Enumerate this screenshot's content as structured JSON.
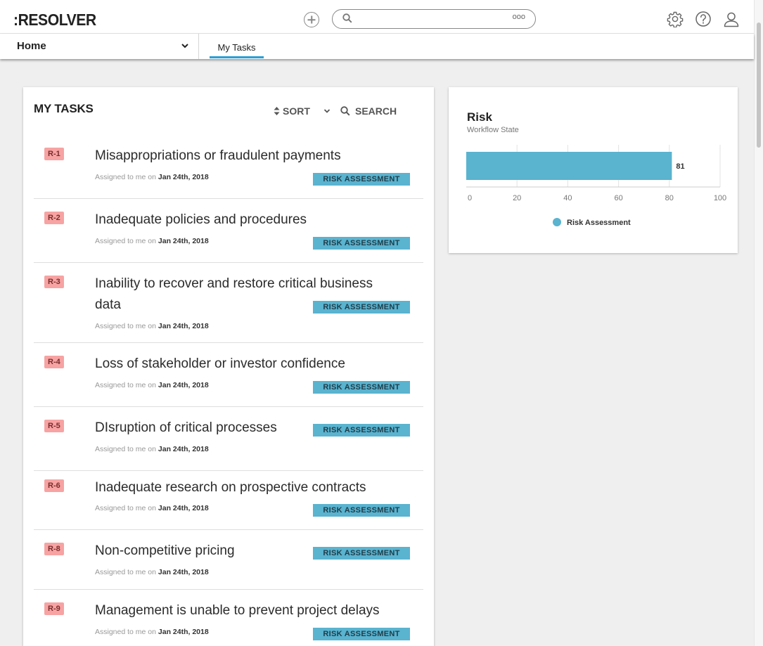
{
  "header": {
    "logo": ":RESOLVER",
    "search_placeholder": "",
    "more_label": "ooo"
  },
  "nav": {
    "home_label": "Home",
    "tab_label": "My Tasks"
  },
  "tasks_panel": {
    "title": "MY TASKS",
    "sort_label": "SORT",
    "search_label": "SEARCH",
    "tasks": [
      {
        "id": "R-1",
        "title": "Misappropriations or fraudulent payments",
        "assigned_prefix": "Assigned to me on",
        "date": "Jan 24th, 2018",
        "state": "RISK ASSESSMENT"
      },
      {
        "id": "R-2",
        "title": "Inadequate policies and procedures",
        "assigned_prefix": "Assigned to me on",
        "date": "Jan 24th, 2018",
        "state": "RISK ASSESSMENT"
      },
      {
        "id": "R-3",
        "title_line1": "Inability to recover and restore critical business",
        "title_line2": "data",
        "assigned_prefix": "Assigned to me on",
        "date": "Jan 24th, 2018",
        "state": "RISK ASSESSMENT"
      },
      {
        "id": "R-4",
        "title": "Loss of stakeholder or investor confidence",
        "assigned_prefix": "Assigned to me on",
        "date": "Jan 24th, 2018",
        "state": "RISK ASSESSMENT"
      },
      {
        "id": "R-5",
        "title": "DIsruption of critical processes",
        "assigned_prefix": "Assigned to me on",
        "date": "Jan 24th, 2018",
        "state": "RISK ASSESSMENT"
      },
      {
        "id": "R-6",
        "title": "Inadequate research on prospective contracts",
        "assigned_prefix": "Assigned to me on",
        "date": "Jan 24th, 2018",
        "state": "RISK ASSESSMENT"
      },
      {
        "id": "R-8",
        "title": "Non-competitive pricing",
        "assigned_prefix": "Assigned to me on",
        "date": "Jan 24th, 2018",
        "state": "RISK ASSESSMENT"
      },
      {
        "id": "R-9",
        "title": "Management is unable to prevent project delays",
        "assigned_prefix": "Assigned to me on",
        "date": "Jan 24th, 2018",
        "state": "RISK ASSESSMENT"
      }
    ]
  },
  "risk_panel": {
    "title": "Risk",
    "subtitle": "Workflow State"
  },
  "chart_data": {
    "type": "bar",
    "orientation": "horizontal",
    "categories": [
      "Risk Assessment"
    ],
    "values": [
      81
    ],
    "x_ticks": [
      "0",
      "20",
      "40",
      "60",
      "80",
      "100"
    ],
    "xlim": [
      0,
      100
    ],
    "value_label": "81",
    "legend": [
      "Risk Assessment"
    ],
    "legend_placement": "bottom",
    "grid": true,
    "bar_color": "#5ab3cf"
  },
  "icons": {
    "add": "plus-circle-icon",
    "search": "magnifier-icon",
    "settings": "gear-icon",
    "help": "question-circle-icon",
    "user": "user-icon",
    "sort": "sort-arrows-icon",
    "chevron": "chevron-down-icon"
  }
}
